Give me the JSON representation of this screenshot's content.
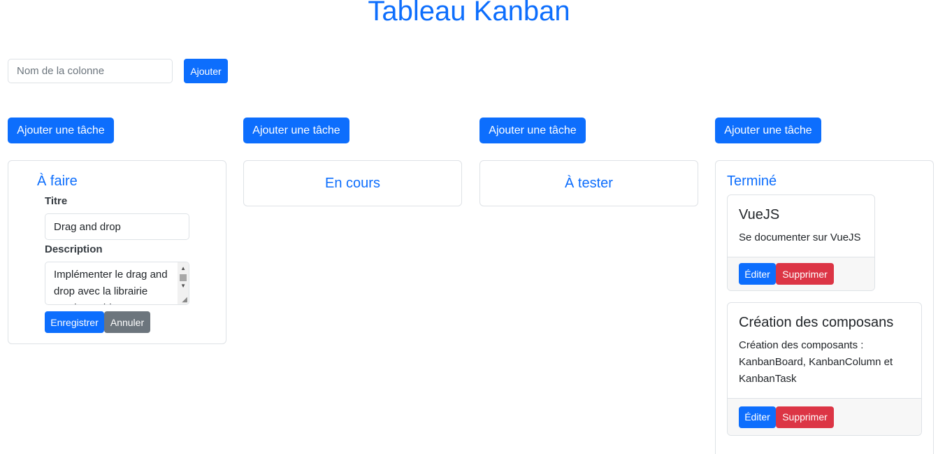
{
  "page": {
    "title": "Tableau Kanban"
  },
  "column_form": {
    "placeholder": "Nom de la colonne",
    "add_label": "Ajouter"
  },
  "add_task_label": "Ajouter une tâche",
  "columns": [
    {
      "title": "À faire",
      "form": {
        "title_label": "Titre",
        "title_value": "Drag and drop",
        "description_label": "Description",
        "description_value": "Implémenter le drag and drop avec la librairie vuedraggable",
        "save_label": "Enregistrer",
        "cancel_label": "Annuler"
      }
    },
    {
      "title": "En cours"
    },
    {
      "title": "À tester"
    },
    {
      "title": "Terminé",
      "tasks": [
        {
          "title": "VueJS",
          "description": "Se documenter sur VueJS",
          "edit_label": "Éditer",
          "delete_label": "Supprimer"
        },
        {
          "title": "Création des composans",
          "description": "Création des composants : KanbanBoard, KanbanColumn et KanbanTask",
          "edit_label": "Éditer",
          "delete_label": "Supprimer"
        }
      ]
    }
  ],
  "colors": {
    "primary": "#0d6efd",
    "danger": "#dc3545",
    "secondary": "#6c757d"
  }
}
